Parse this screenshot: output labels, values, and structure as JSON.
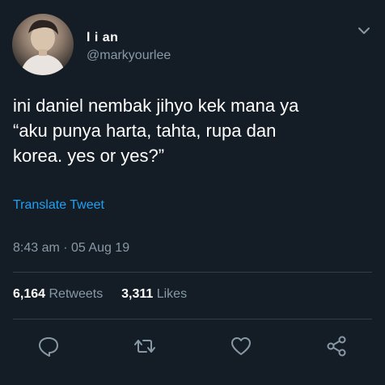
{
  "user": {
    "display_name": "l i an",
    "handle": "@markyourlee",
    "avatar_icon": "profile-avatar"
  },
  "tweet": {
    "lines": [
      "ini daniel nembak jihyo kek mana ya",
      "“aku punya harta, tahta, rupa dan",
      "korea. yes or yes?”"
    ]
  },
  "translate_label": "Translate Tweet",
  "timestamp": "8:43 am · 05 Aug 19",
  "stats": {
    "retweets_count": "6,164",
    "retweets_label": "Retweets",
    "likes_count": "3,311",
    "likes_label": "Likes"
  },
  "actions": [
    "reply-icon",
    "retweet-icon",
    "like-icon",
    "share-icon"
  ],
  "colors": {
    "background": "#141d26",
    "secondary_text": "#8899a6",
    "link": "#1da1f2",
    "divider": "#2f3d4a"
  }
}
